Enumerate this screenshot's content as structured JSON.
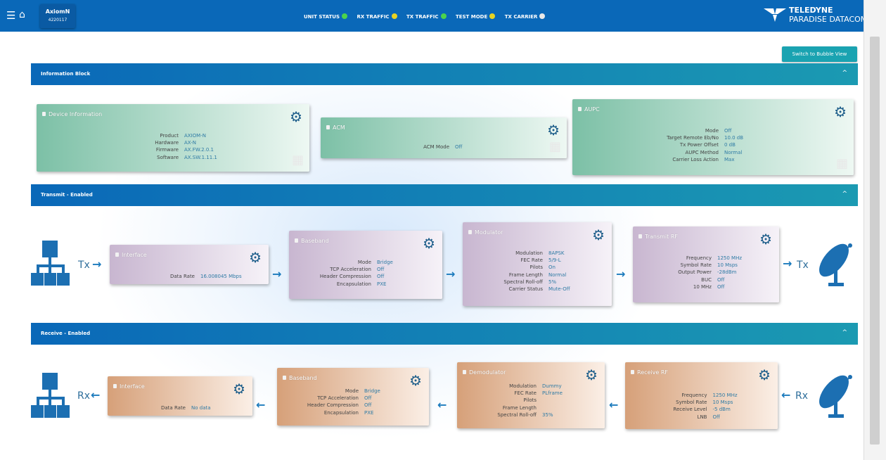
{
  "header": {
    "unit_name": "AxiomN",
    "unit_serial": "4220117",
    "status": [
      {
        "label": "UNIT STATUS",
        "color": "#4cd34c"
      },
      {
        "label": "RX TRAFFIC",
        "color": "#e7d323"
      },
      {
        "label": "TX TRAFFIC",
        "color": "#4cd34c"
      },
      {
        "label": "TEST MODE",
        "color": "#e7d323"
      },
      {
        "label": "TX CARRIER",
        "color": "#e8e8e8"
      }
    ],
    "logo_line1": "TELEDYNE",
    "logo_line2": "PARADISE DATACOM"
  },
  "bubble_button": "Switch to Bubble View",
  "sections": {
    "info": "Information Block",
    "transmit": "Transmit - Enabled",
    "receive": "Receive - Enabled"
  },
  "labels": {
    "tx": "Tx",
    "rx": "Rx"
  },
  "info": {
    "device": {
      "title": "Device Information",
      "rows": [
        {
          "label": "Product",
          "value": "AXIOM-N"
        },
        {
          "label": "Hardware",
          "value": "AX-N"
        },
        {
          "label": "Firmware",
          "value": "AX.FW.2.0.1"
        },
        {
          "label": "Software",
          "value": "AX.SW.1.11.1"
        }
      ]
    },
    "acm": {
      "title": "ACM",
      "rows": [
        {
          "label": "ACM Mode",
          "value": "Off"
        }
      ]
    },
    "aupc": {
      "title": "AUPC",
      "rows": [
        {
          "label": "Mode",
          "value": "Off"
        },
        {
          "label": "Target Remote Eb/No",
          "value": "10.0 dB"
        },
        {
          "label": "Tx Power Offset",
          "value": "0 dB"
        },
        {
          "label": "AUPC Method",
          "value": "Normal"
        },
        {
          "label": "Carrier Loss Action",
          "value": "Max"
        }
      ]
    }
  },
  "transmit": {
    "interface": {
      "title": "Interface",
      "rows": [
        {
          "label": "Data Rate",
          "value": "16.008045 Mbps"
        }
      ]
    },
    "baseband": {
      "title": "Baseband",
      "rows": [
        {
          "label": "Mode",
          "value": "Bridge"
        },
        {
          "label": "TCP Acceleration",
          "value": "Off"
        },
        {
          "label": "Header Compression",
          "value": "Off"
        },
        {
          "label": "Encapsulation",
          "value": "PXE"
        }
      ]
    },
    "modulator": {
      "title": "Modulator",
      "rows": [
        {
          "label": "Modulation",
          "value": "8APSK"
        },
        {
          "label": "FEC Rate",
          "value": "5/9-L"
        },
        {
          "label": "Pilots",
          "value": "On"
        },
        {
          "label": "Frame Length",
          "value": "Normal"
        },
        {
          "label": "Spectral Roll-off",
          "value": "5%"
        },
        {
          "label": "Carrier Status",
          "value": "Mute-Off"
        }
      ]
    },
    "rf": {
      "title": "Transmit RF",
      "rows": [
        {
          "label": "Frequency",
          "value": "1250 MHz"
        },
        {
          "label": "Symbol Rate",
          "value": "10 Msps"
        },
        {
          "label": "Output Power",
          "value": "-28dBm"
        },
        {
          "label": "BUC",
          "value": "Off"
        },
        {
          "label": "10 MHz",
          "value": "Off"
        }
      ]
    }
  },
  "receive": {
    "interface": {
      "title": "Interface",
      "rows": [
        {
          "label": "Data Rate",
          "value": "No data"
        }
      ]
    },
    "baseband": {
      "title": "Baseband",
      "rows": [
        {
          "label": "Mode",
          "value": "Bridge"
        },
        {
          "label": "TCP Acceleration",
          "value": "Off"
        },
        {
          "label": "Header Compression",
          "value": "Off"
        },
        {
          "label": "Encapsulation",
          "value": "PXE"
        }
      ]
    },
    "demodulator": {
      "title": "Demodulator",
      "rows": [
        {
          "label": "Modulation",
          "value": "Dummy"
        },
        {
          "label": "FEC Rate",
          "value": "PLframe"
        },
        {
          "label": "Pilots",
          "value": ""
        },
        {
          "label": "Frame Length",
          "value": ""
        },
        {
          "label": "Spectral Roll-off",
          "value": "35%"
        }
      ]
    },
    "rf": {
      "title": "Receive RF",
      "rows": [
        {
          "label": "Frequency",
          "value": "1250 MHz"
        },
        {
          "label": "Symbol Rate",
          "value": "10 Msps"
        },
        {
          "label": "Receive Level",
          "value": "-5 dBm"
        },
        {
          "label": "LNB",
          "value": "Off"
        }
      ]
    }
  }
}
